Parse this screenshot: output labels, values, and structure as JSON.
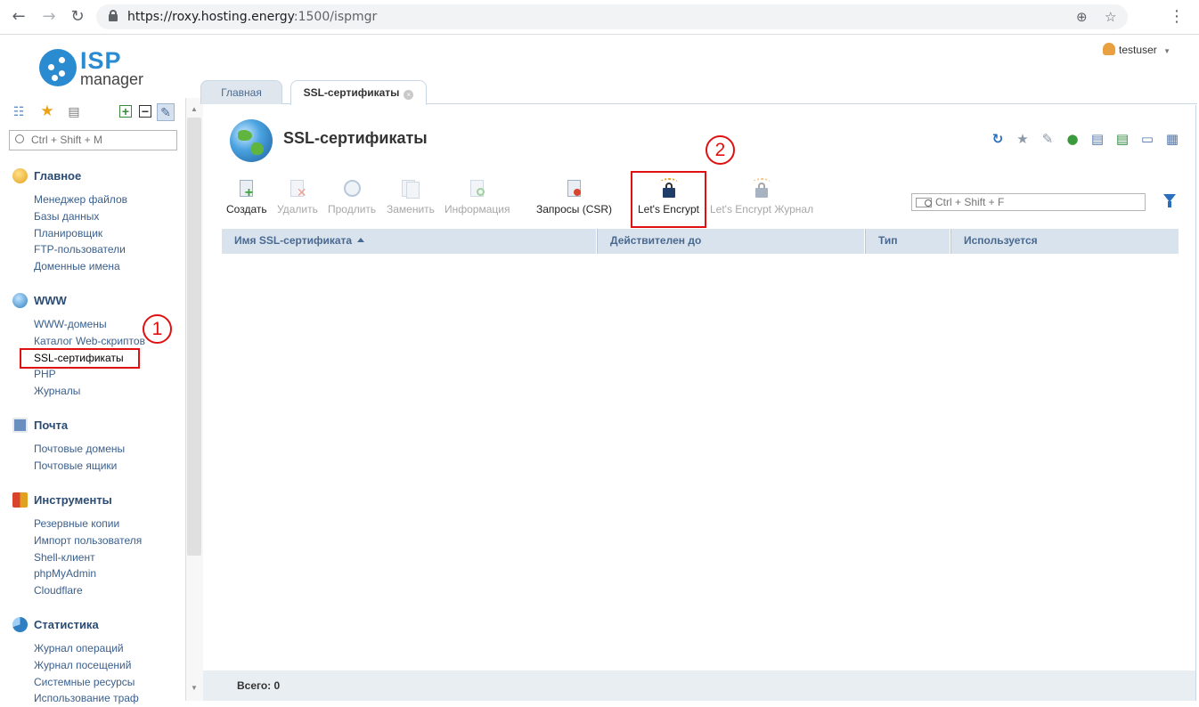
{
  "browser": {
    "url_host": "https://roxy.hosting.energy",
    "url_path": ":1500/ispmgr"
  },
  "user": {
    "name": "testuser",
    "caret": "▼"
  },
  "logo": {
    "top": "ISP",
    "bottom": "manager"
  },
  "sidebar": {
    "search_placeholder": "Ctrl + Shift + M",
    "groups": [
      {
        "title": "Главное",
        "items": [
          "Менеджер файлов",
          "Базы данных",
          "Планировщик",
          "FTP-пользователи",
          "Доменные имена"
        ]
      },
      {
        "title": "WWW",
        "items": [
          "WWW-домены",
          "Каталог Web-скриптов",
          "SSL-сертификаты",
          "PHP",
          "Журналы"
        ]
      },
      {
        "title": "Почта",
        "items": [
          "Почтовые домены",
          "Почтовые ящики"
        ]
      },
      {
        "title": "Инструменты",
        "items": [
          "Резервные копии",
          "Импорт пользователя",
          "Shell-клиент",
          "phpMyAdmin",
          "Cloudflare"
        ]
      },
      {
        "title": "Статистика",
        "items": [
          "Журнал операций",
          "Журнал посещений",
          "Системные ресурсы",
          "Использование траф"
        ]
      }
    ]
  },
  "tabs": [
    {
      "label": "Главная"
    },
    {
      "label": "SSL-сертификаты",
      "close": "×"
    }
  ],
  "page": {
    "title": "SSL-сертификаты"
  },
  "toolbar": {
    "buttons": [
      {
        "label": "Создать",
        "enabled": true
      },
      {
        "label": "Удалить",
        "enabled": false
      },
      {
        "label": "Продлить",
        "enabled": false
      },
      {
        "label": "Заменить",
        "enabled": false
      },
      {
        "label": "Информация",
        "enabled": false
      },
      {
        "label": "Запросы (CSR)",
        "enabled": true
      },
      {
        "label": "Let's Encrypt",
        "enabled": true
      },
      {
        "label": "Let's Encrypt Журнал",
        "enabled": false
      }
    ],
    "filter_placeholder": "Ctrl + Shift + F"
  },
  "table": {
    "columns": [
      "Имя SSL-сертификата",
      "Действителен до",
      "Тип",
      "Используется"
    ],
    "rows": []
  },
  "footer": {
    "total": "Всего: 0"
  },
  "annotations": {
    "one": "1",
    "two": "2",
    "color": "#e01010"
  }
}
